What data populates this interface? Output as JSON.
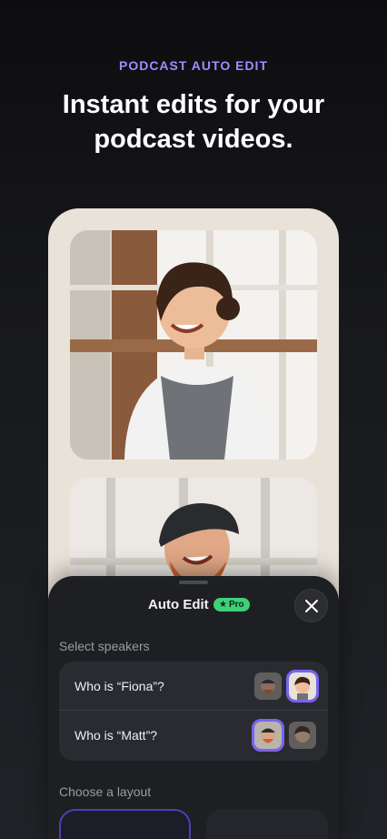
{
  "header": {
    "eyebrow": "PODCAST AUTO EDIT",
    "headline_line1": "Instant edits for your",
    "headline_line2": "podcast videos."
  },
  "sheet": {
    "title": "Auto Edit",
    "badge_icon": "star-icon",
    "badge_label": "Pro",
    "close_icon": "close-icon",
    "select_speakers_label": "Select speakers",
    "speakers": [
      {
        "question": "Who is “Fiona”?",
        "selected_option": 2
      },
      {
        "question": "Who is “Matt”?",
        "selected_option": 1
      }
    ],
    "choose_layout_label": "Choose a layout"
  },
  "colors": {
    "accent": "#a18cff",
    "selection": "#7a62f2",
    "pro_badge": "#3fd07a",
    "sheet_bg": "#1e1f23",
    "card_bg": "#2a2b30"
  }
}
